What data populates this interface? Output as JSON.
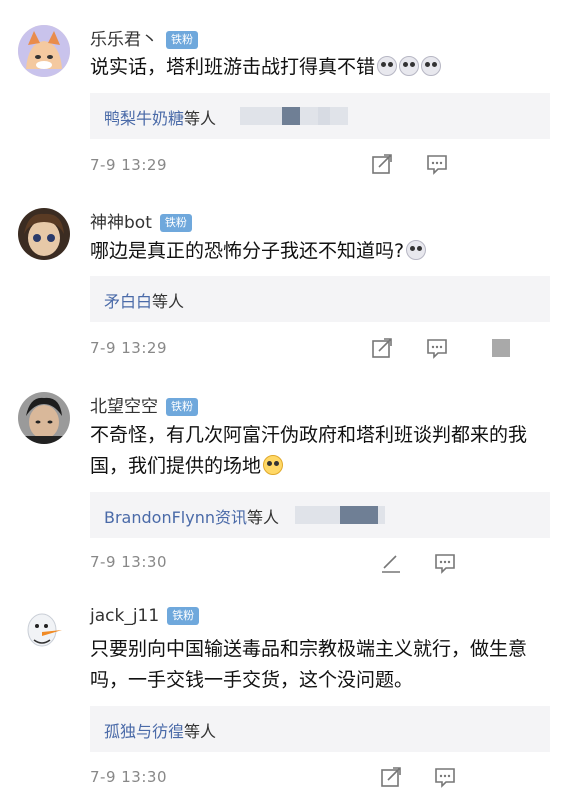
{
  "comments": [
    {
      "username": "乐乐君丶",
      "badge": "铁粉",
      "text": "说实话，塔利班游击战打得真不错",
      "emojis": [
        "grimace-emoji",
        "grimace-emoji",
        "grimace-emoji"
      ],
      "reply_names": "鸭梨牛奶糖",
      "reply_suffix": "等人",
      "time": "7-9 13:29",
      "avatar": "cartoon-cat-avatar"
    },
    {
      "username": "神神bot",
      "badge": "铁粉",
      "text": "哪边是真正的恐怖分子我还不知道吗?",
      "emojis": [
        "grimace-emoji"
      ],
      "reply_names": "矛白白",
      "reply_suffix": "等人",
      "time": "7-9 13:29",
      "avatar": "anime-girl-avatar"
    },
    {
      "username": "北望空空",
      "badge": "铁粉",
      "text": "不奇怪，有几次阿富汗伪政府和塔利班谈判都来的我国，我们提供的场地",
      "emojis": [
        "grin-emoji"
      ],
      "reply_names": "BrandonFlynn资讯",
      "reply_suffix": "等人",
      "time": "7-9 13:30",
      "avatar": "boy-photo-avatar"
    },
    {
      "username": "jack_j11",
      "badge": "铁粉",
      "text": "只要别向中国输送毒品和宗教极端主义就行，做生意吗，一手交钱一手交货，这个没问题。",
      "emojis": [],
      "reply_names": "孤独与彷徨",
      "reply_suffix": "等人",
      "time": "7-9 13:30",
      "avatar": "snowman-avatar"
    }
  ],
  "icons": {
    "share": "share-icon",
    "reply": "reply-icon"
  },
  "colors": {
    "name_blue": "#4a6aa8",
    "badge_blue": "#6fa8dc",
    "reply_bg": "#f4f4f6"
  }
}
